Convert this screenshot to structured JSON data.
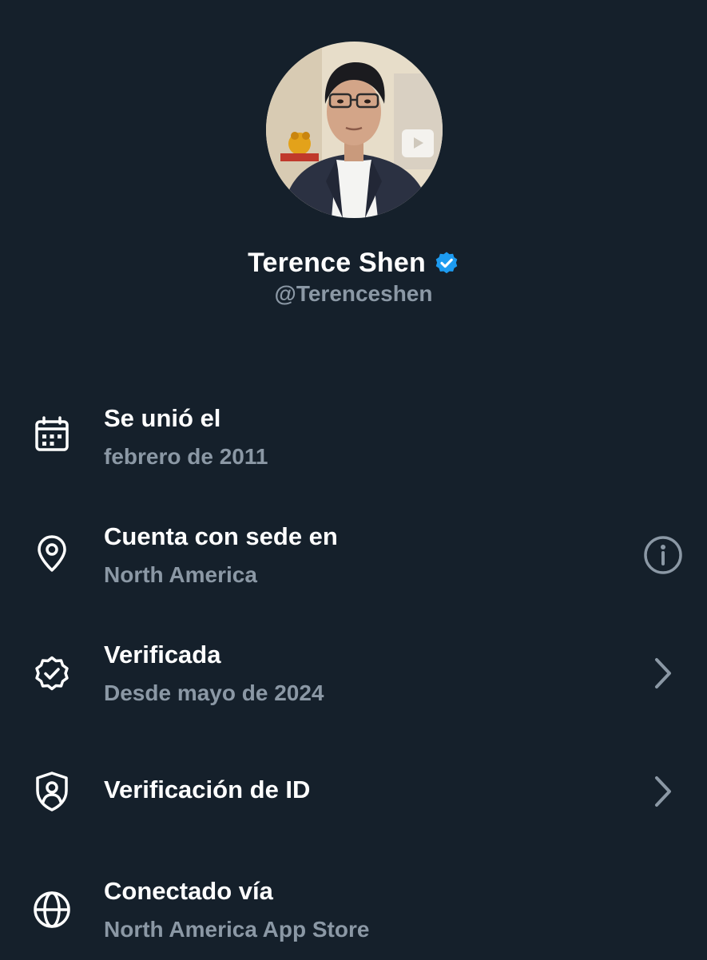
{
  "profile": {
    "display_name": "Terence Shen",
    "handle": "@Terenceshen",
    "verified_badge_color": "#1d9bf0",
    "avatar_icon": "profile-photo"
  },
  "about": [
    {
      "icon": "calendar-icon",
      "title": "Se unió el",
      "subtitle": "febrero de 2011"
    },
    {
      "icon": "location-pin-icon",
      "title": "Cuenta con sede en",
      "subtitle": "North America",
      "trailing_icon": "info-icon"
    },
    {
      "icon": "verified-badge-outline-icon",
      "title": "Verificada",
      "subtitle": "Desde mayo de 2024",
      "trailing_icon": "chevron-right-icon"
    },
    {
      "icon": "shield-person-icon",
      "title": "Verificación de ID",
      "trailing_icon": "chevron-right-icon"
    },
    {
      "icon": "globe-icon",
      "title": "Conectado vía",
      "subtitle": "North America App Store"
    }
  ],
  "colors": {
    "background": "#15202b",
    "primary_text": "#ffffff",
    "secondary_text": "#8b98a5",
    "accent": "#1d9bf0"
  }
}
